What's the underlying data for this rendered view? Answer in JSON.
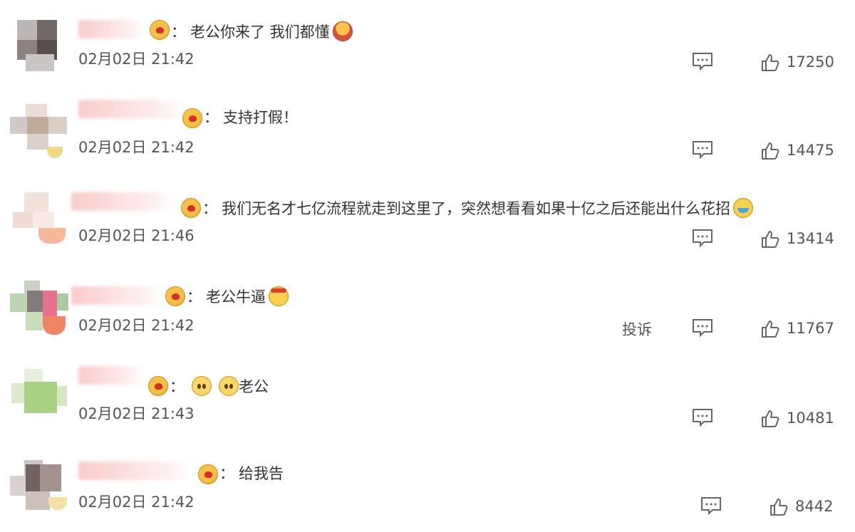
{
  "comments": [
    {
      "text": "老公你来了 我们都懂",
      "emoji": [
        "mask-emoji"
      ],
      "time": "02月02日 21:42",
      "likes": "17250"
    },
    {
      "text": "支持打假！",
      "emoji": [],
      "time": "02月02日 21:42",
      "likes": "14475"
    },
    {
      "text": "我们无名才七亿流程就走到这里了，突然想看看如果十亿之后还能出什么花招",
      "emoji": [
        "laugh-cry-emoji"
      ],
      "time": "02月02日 21:46",
      "likes": "13414"
    },
    {
      "text": "老公牛逼",
      "emoji": [
        "strong-emoji"
      ],
      "time": "02月02日 21:42",
      "likes": "11767",
      "report": "投诉"
    },
    {
      "text": "老公",
      "emoji": [
        "pout-emoji",
        "pout-emoji"
      ],
      "time": "02月02日 21:43",
      "likes": "10481"
    },
    {
      "text": "给我告",
      "emoji": [],
      "time": "02月02日 21:42",
      "likes": "8442"
    }
  ],
  "colon": "：",
  "icons": {
    "comment": "comment-icon",
    "like": "thumbs-up-icon",
    "badge": "fan-badge-icon"
  },
  "colors": {
    "text": "#333333",
    "meta": "#555555",
    "name_blur": "#f5a0a0"
  }
}
